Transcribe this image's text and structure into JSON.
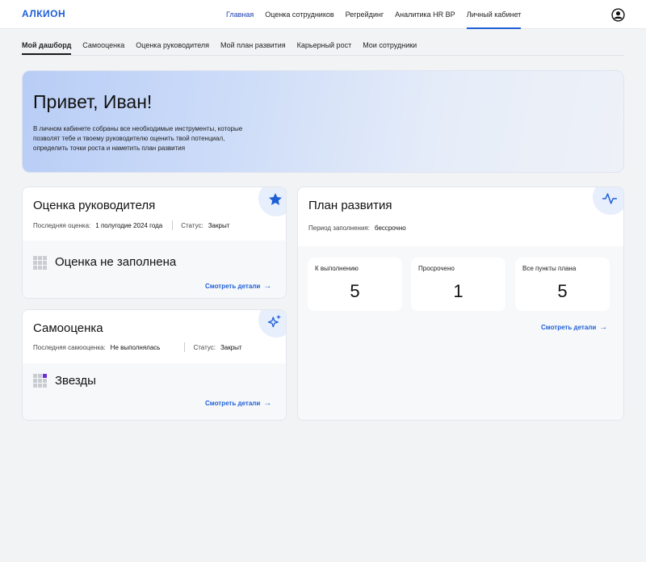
{
  "app": {
    "logo": "АЛКИОН"
  },
  "topnav": {
    "items": [
      "Главная",
      "Оценка сотрудников",
      "Регрейдинг",
      "Аналитика HR BP",
      "Личный кабинет"
    ]
  },
  "subnav": {
    "tabs": [
      "Мой дашборд",
      "Самооценка",
      "Оценка руководителя",
      "Мой план развития",
      "Карьерный рост",
      "Мои сотрудники"
    ]
  },
  "hero": {
    "greeting": "Привет, Иван!",
    "description": "В личном кабинете собраны все необходимые инструменты, которые позволят тебе и твоему руководителю оценить твой потенциал, определить точки роста и наметить план развития"
  },
  "manager_review": {
    "title": "Оценка руководителя",
    "last_label": "Последняя оценка:",
    "last_value": "1 полугодие 2024 года",
    "status_label": "Статус:",
    "status_value": "Закрыт",
    "state": "Оценка не заполнена",
    "link": "Смотреть детали",
    "icon": "star-icon"
  },
  "self_review": {
    "title": "Самооценка",
    "last_label": "Последняя самооценка:",
    "last_value": "Не выполнялась",
    "status_label": "Статус:",
    "status_value": "Закрыт",
    "state": "Звезды",
    "link": "Смотреть детали",
    "icon": "sparkle-icon"
  },
  "dev_plan": {
    "title": "План развития",
    "period_label": "Период заполнения:",
    "period_value": "бессрочно",
    "stats": [
      {
        "label": "К выполнению",
        "value": "5"
      },
      {
        "label": "Просрочено",
        "value": "1"
      },
      {
        "label": "Все пункты плана",
        "value": "5"
      }
    ],
    "link": "Смотреть детали",
    "icon": "pulse-icon"
  },
  "colors": {
    "accent": "#1e5fd6",
    "badge_bg": "#e7eefc",
    "accent_purple": "#6b2fd9"
  }
}
